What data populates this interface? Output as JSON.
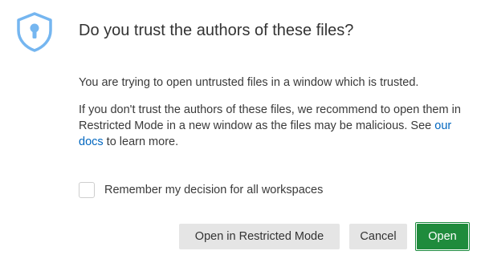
{
  "dialog": {
    "title": "Do you trust the authors of these files?",
    "message": {
      "intro": "You are trying to open untrusted files in a window which is trusted.",
      "detail_before_link": "If you don't trust the authors of these files, we recommend to open them in Restricted Mode in a new window as the files may be malicious. See ",
      "link_text": "our docs",
      "detail_after_link": " to learn more."
    },
    "checkbox": {
      "label": "Remember my decision for all workspaces",
      "checked": false
    },
    "buttons": {
      "restricted_label": "Open in Restricted Mode",
      "cancel_label": "Cancel",
      "open_label": "Open"
    },
    "icon": "shield-lock-icon",
    "colors": {
      "icon": "#75b6f0",
      "link": "#0066bf",
      "primary_button": "#1f8b3c",
      "secondary_button": "#e5e5e5"
    }
  }
}
